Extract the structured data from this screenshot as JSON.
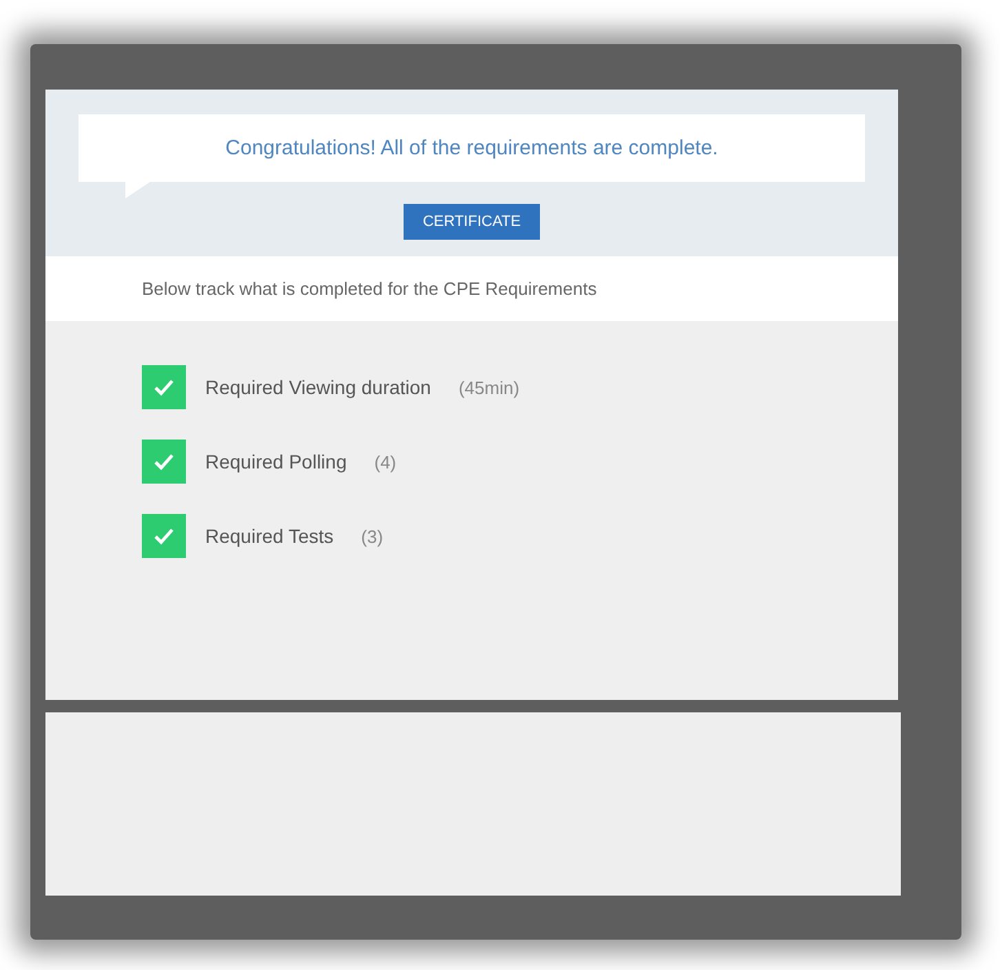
{
  "banner": {
    "message": "Congratulations! All of the requirements are complete.",
    "button": "CERTIFICATE"
  },
  "intro": "Below track what is completed for the CPE Requirements",
  "requirements": [
    {
      "label": "Required Viewing duration",
      "count": "(45min)",
      "checked": true
    },
    {
      "label": "Required Polling",
      "count": "(4)",
      "checked": true
    },
    {
      "label": "Required Tests",
      "count": "(3)",
      "checked": true
    }
  ]
}
